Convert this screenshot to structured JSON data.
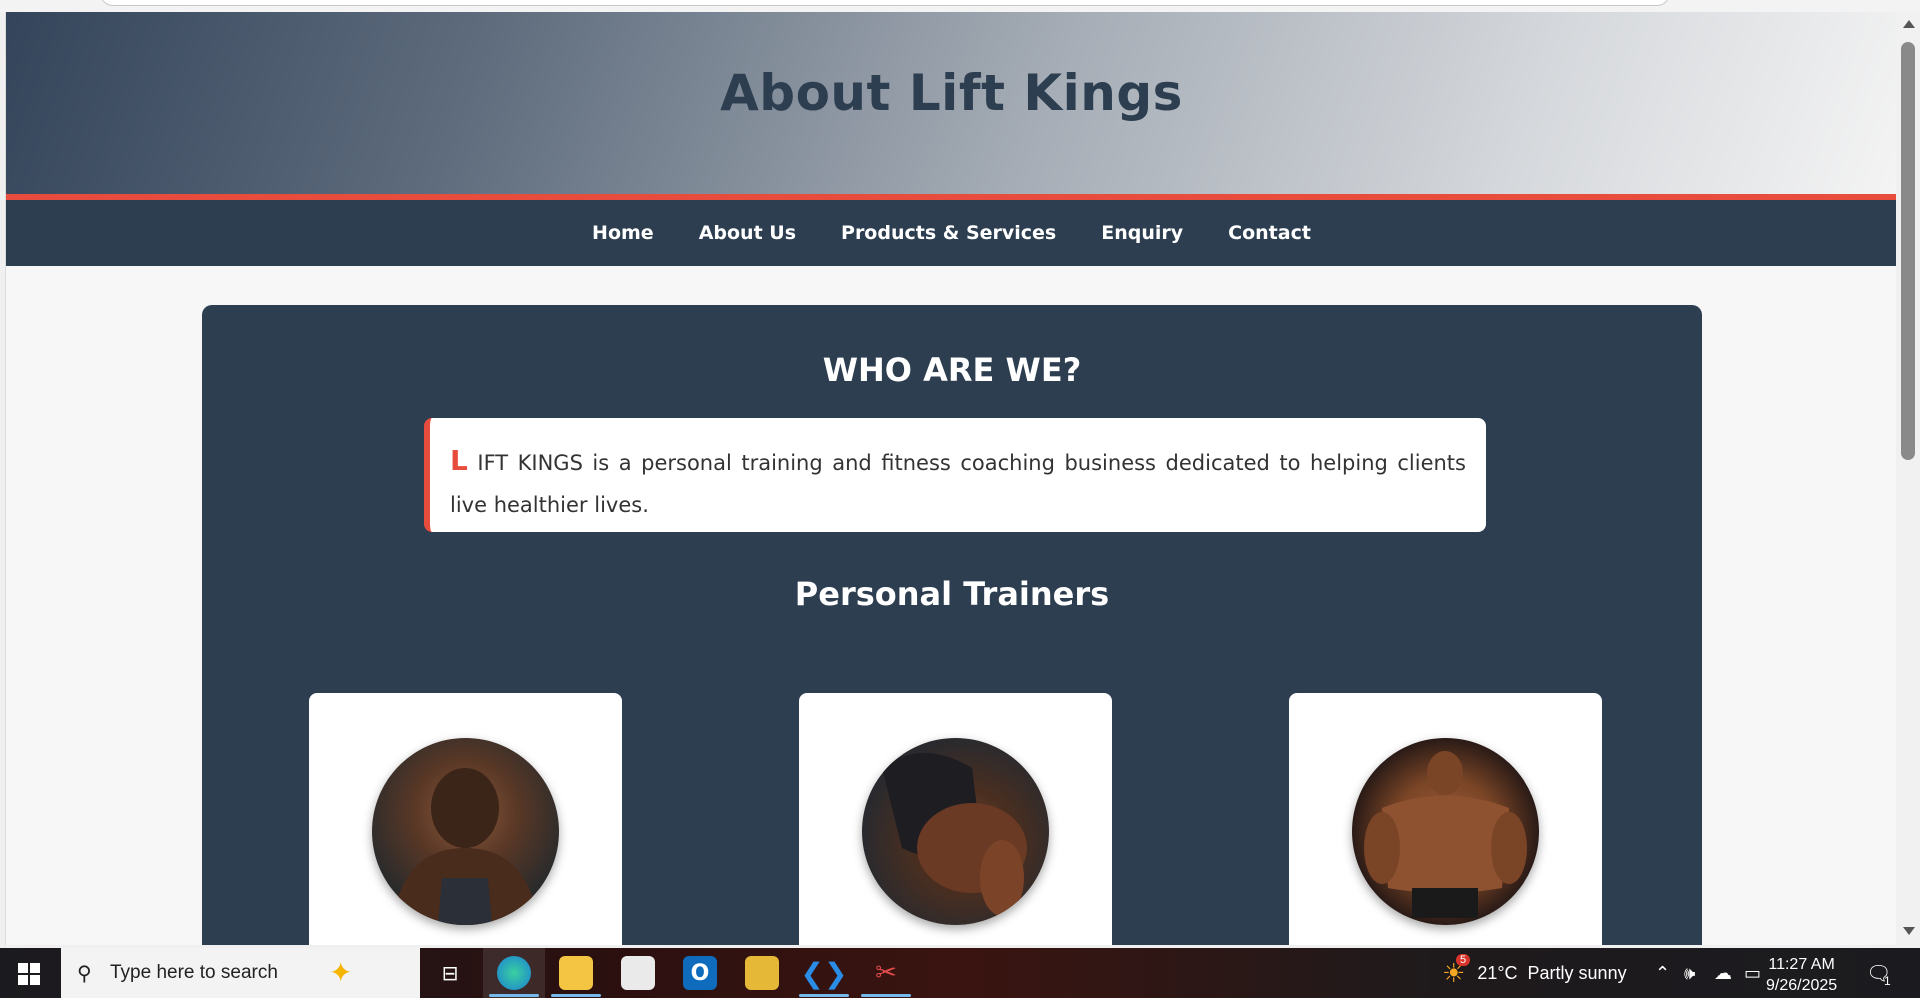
{
  "page": {
    "hero_title": "About Lift Kings",
    "nav": [
      "Home",
      "About Us",
      "Products & Services",
      "Enquiry",
      "Contact"
    ]
  },
  "content": {
    "section_title": "WHO ARE WE?",
    "intro_dropcap": "L",
    "intro_text": "IFT KINGS is a personal training and fitness coaching business dedicated to helping clients live healthier lives.",
    "trainers_title": "Personal Trainers",
    "trainers": [
      {
        "photo": "trainer-1-portrait"
      },
      {
        "photo": "trainer-2-back-pose"
      },
      {
        "photo": "trainer-3-front-pose"
      }
    ]
  },
  "taskbar": {
    "search_placeholder": "Type here to search",
    "weather": "21°C  Partly sunny",
    "weather_badge": "5",
    "time": "11:27 AM",
    "date": "9/26/2025",
    "notification_count": "1",
    "apps": [
      "task-view-icon",
      "edge-icon",
      "file-explorer-icon",
      "store-icon",
      "outlook-icon",
      "sticky-app-icon",
      "vscode-icon",
      "snipping-tool-icon"
    ]
  },
  "colors": {
    "navy": "#2c3e50",
    "accent_red": "#e74c3c"
  }
}
